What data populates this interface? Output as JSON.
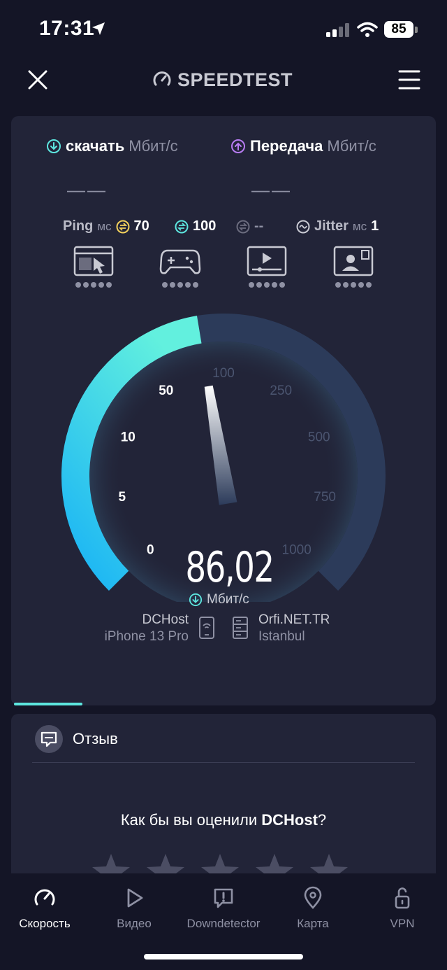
{
  "status_bar": {
    "time": "17:31",
    "battery": "85"
  },
  "header": {
    "logo_text": "SPEEDTEST"
  },
  "metrics": {
    "download_label": "скачать",
    "download_unit": "Мбит/с",
    "download_value": "——",
    "upload_label": "Передача",
    "upload_unit": "Мбит/с",
    "upload_value": "——"
  },
  "ping": {
    "label": "Ping",
    "unit": "мс",
    "idle": "70",
    "download": "100",
    "upload": "--",
    "jitter_label": "Jitter",
    "jitter_unit": "мс",
    "jitter_value": "1"
  },
  "services": [
    {
      "icon": "browsing-icon",
      "rating_dots": 5
    },
    {
      "icon": "gaming-icon",
      "rating_dots": 5
    },
    {
      "icon": "video-streaming-icon",
      "rating_dots": 5
    },
    {
      "icon": "video-call-icon",
      "rating_dots": 5
    }
  ],
  "gauge": {
    "ticks": [
      "0",
      "5",
      "10",
      "50",
      "100",
      "250",
      "500",
      "750",
      "1000"
    ],
    "current_value": 86.02,
    "display_value": "86,02",
    "unit": "Мбит/с",
    "colors": {
      "active": "#5de6df",
      "active_end": "#19b3f5",
      "inactive": "#2c3b5a"
    }
  },
  "connection": {
    "isp": "DCHost",
    "device": "iPhone 13 Pro",
    "server": "Orfi.NET.TR",
    "city": "Istanbul"
  },
  "feedback": {
    "title": "Отзыв",
    "question_prefix": "Как бы вы оценили ",
    "question_brand": "DCHost",
    "question_suffix": "?",
    "stars": 5
  },
  "tabs": [
    {
      "label": "Скорость",
      "icon": "speedometer-icon",
      "active": true
    },
    {
      "label": "Видео",
      "icon": "play-icon",
      "active": false
    },
    {
      "label": "Downdetector",
      "icon": "alert-icon",
      "active": false
    },
    {
      "label": "Карта",
      "icon": "map-pin-icon",
      "active": false
    },
    {
      "label": "VPN",
      "icon": "lock-icon",
      "active": false
    }
  ]
}
